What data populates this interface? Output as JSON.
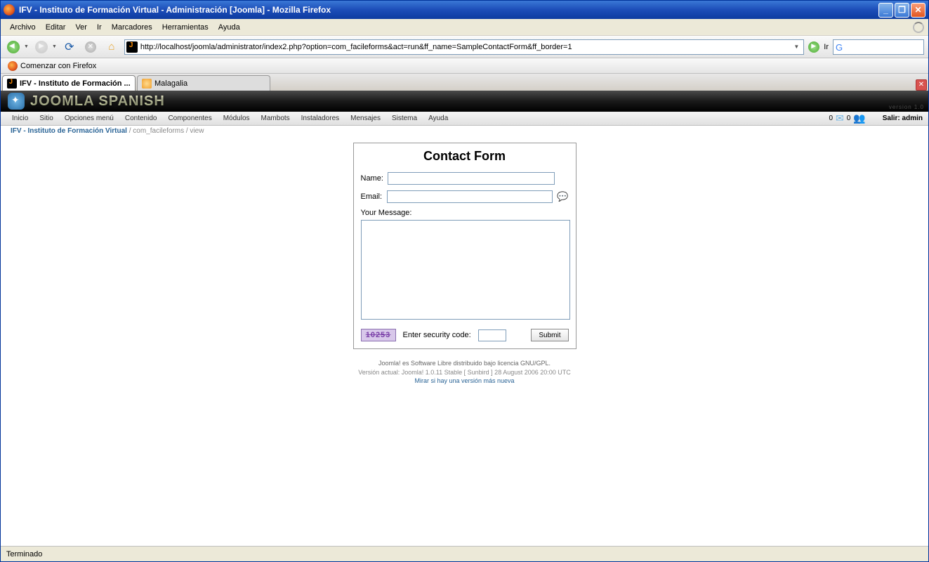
{
  "browser": {
    "title": "IFV - Instituto de Formación Virtual - Administración [Joomla] - Mozilla Firefox",
    "menus": [
      "Archivo",
      "Editar",
      "Ver",
      "Ir",
      "Marcadores",
      "Herramientas",
      "Ayuda"
    ],
    "url": "http://localhost/joomla/administrator/index2.php?option=com_facileforms&act=run&ff_name=SampleContactForm&ff_border=1",
    "go_label": "Ir",
    "bookmark": "Comenzar con Firefox",
    "tabs": [
      {
        "label": "IFV - Instituto de Formación ...",
        "active": true
      },
      {
        "label": "Malagalia",
        "active": false
      }
    ],
    "status": "Terminado"
  },
  "joomla": {
    "brand": "JOOMLA SPANISH",
    "version_tag": "version 1.0",
    "menu": [
      "Inicio",
      "Sitio",
      "Opciones menú",
      "Contenido",
      "Componentes",
      "Módulos",
      "Mambots",
      "Instaladores",
      "Mensajes",
      "Sistema",
      "Ayuda"
    ],
    "mail_count": "0",
    "user_count": "0",
    "logout": "Salir: admin",
    "breadcrumb_main": "IFV - Instituto de Formación Virtual",
    "breadcrumb_rest": " / com_facileforms / view"
  },
  "form": {
    "title": "Contact Form",
    "name_label": "Name:",
    "name_value": "",
    "email_label": "Email:",
    "email_value": "",
    "message_label": "Your Message:",
    "message_value": "",
    "captcha_code": "10253",
    "captcha_label": "Enter security code:",
    "captcha_value": "",
    "submit_label": "Submit"
  },
  "footer": {
    "line1": "Joomla! es Software Libre distribuido bajo licencia GNU/GPL.",
    "line2": "Versión actual: Joomla! 1.0.11 Stable [ Sunbird ] 28 August 2006 20:00 UTC",
    "line3": "Mirar si hay una versión más nueva"
  }
}
